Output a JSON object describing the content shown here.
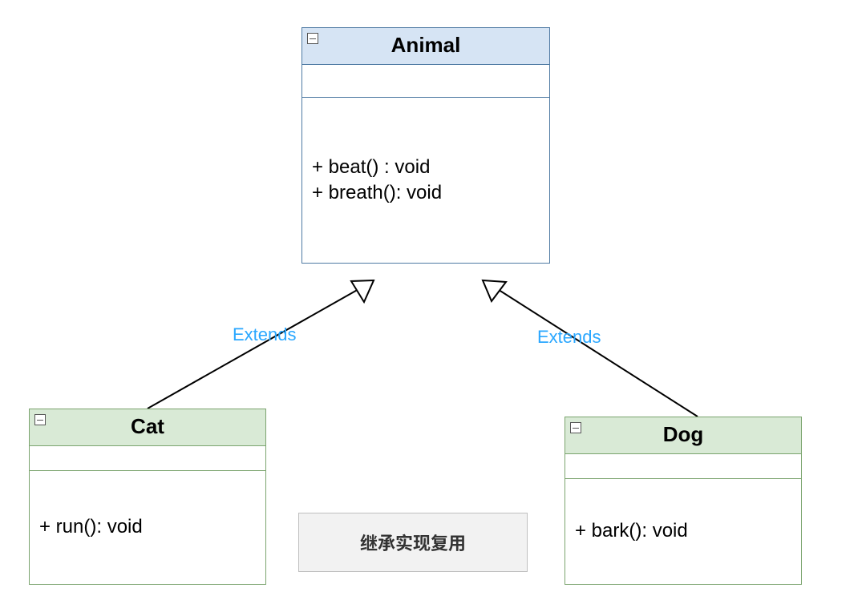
{
  "classes": {
    "animal": {
      "name": "Animal",
      "methods": [
        "+ beat() : void",
        "+ breath(): void"
      ],
      "header_fill": "#d6e4f4",
      "border": "#4f7aa3"
    },
    "cat": {
      "name": "Cat",
      "methods": [
        "+ run(): void"
      ],
      "header_fill": "#d9ead6",
      "border": "#7ba46e"
    },
    "dog": {
      "name": "Dog",
      "methods": [
        "+ bark(): void"
      ],
      "header_fill": "#d9ead6",
      "border": "#7ba46e"
    }
  },
  "relations": {
    "cat_extends": {
      "label": "Extends"
    },
    "dog_extends": {
      "label": "Extends"
    }
  },
  "note": {
    "text": "继承实现复用"
  },
  "chart_data": {
    "type": "uml_class_diagram",
    "classes": [
      {
        "id": "Animal",
        "methods": [
          "+ beat() : void",
          "+ breath(): void"
        ]
      },
      {
        "id": "Cat",
        "methods": [
          "+ run(): void"
        ]
      },
      {
        "id": "Dog",
        "methods": [
          "+ bark(): void"
        ]
      }
    ],
    "relations": [
      {
        "from": "Cat",
        "to": "Animal",
        "type": "extends",
        "label": "Extends"
      },
      {
        "from": "Dog",
        "to": "Animal",
        "type": "extends",
        "label": "Extends"
      }
    ],
    "note": "继承实现复用"
  }
}
